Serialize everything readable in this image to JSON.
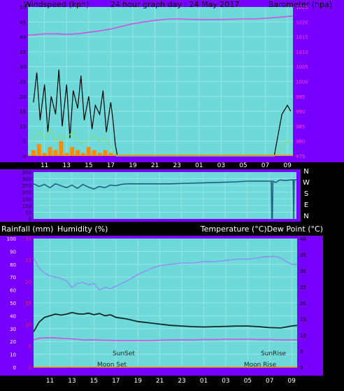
{
  "top_panel": {
    "left_title": "Windspeed (kph)",
    "center_title": "24 hour graph day : 24 May 2017",
    "right_title": "Barometer (hpa)"
  },
  "direction_letters": [
    "N",
    "W",
    "S",
    "E",
    "N"
  ],
  "bottom_panel": {
    "left_title_1": "Rainfall (mm)",
    "left_title_2": "Humidity (%)",
    "right_title": "Temperature (°C)Dew Point (°C)",
    "sunset_label": "SunSet",
    "sunrise_label": "SunRise",
    "moonset_label": "Moon Set",
    "moonrise_label": "Moon Rise"
  },
  "colors": {
    "frame": "#000000",
    "side": "#7700ff",
    "plot_bg": "#6fd9d9",
    "grid": "#9be8e8",
    "wind_gust": "#000000",
    "wind_avg": "#80e070",
    "rain": "#ff8c00",
    "barometer": "#d050e0",
    "direction": "#1f5f80",
    "humidity": "#8898f0",
    "temperature": "#102828",
    "dew_point": "#d050e0",
    "axis_red": "#ff2020"
  },
  "x_ticks": [
    "11",
    "13",
    "15",
    "17",
    "19",
    "21",
    "23",
    "01",
    "03",
    "05",
    "07",
    "09"
  ],
  "chart_data": [
    {
      "type": "line",
      "title": "24 hour graph day : 24 May 2017",
      "y_left_label": "Windspeed (kph)",
      "y_right_label": "Barometer (hpa)",
      "x_hours": [
        9.5,
        33.5
      ],
      "y_left_ticks": [
        "0",
        "5",
        "10",
        "15",
        "20",
        "25",
        "30",
        "35",
        "40",
        "45",
        "50"
      ],
      "y_left_range": [
        0,
        50
      ],
      "y_right_ticks": [
        "975",
        "980",
        "985",
        "990",
        "995",
        "1000",
        "1005",
        "1010",
        "1015",
        "1020",
        "1025"
      ],
      "y_right_range": [
        975,
        1025
      ],
      "series": [
        {
          "key": "gust",
          "x": [
            10,
            10.3,
            10.6,
            11,
            11.3,
            11.6,
            12,
            12.3,
            12.6,
            13,
            13.3,
            13.6,
            14,
            14.3,
            14.6,
            15,
            15.3,
            15.6,
            16,
            16.3,
            16.6,
            17,
            17.2,
            17.4,
            17.6,
            31.8,
            32,
            32.5,
            33,
            33.3
          ],
          "y": [
            18,
            28,
            12,
            24,
            8,
            20,
            14,
            29,
            10,
            24,
            6,
            22,
            16,
            27,
            12,
            20,
            9,
            17,
            14,
            22,
            8,
            18,
            12,
            4,
            0,
            0,
            4,
            14,
            17,
            15
          ]
        },
        {
          "key": "average",
          "x": [
            10,
            10.5,
            11,
            11.5,
            12,
            12.5,
            13,
            13.5,
            14,
            14.5,
            15,
            15.5,
            16,
            16.5,
            17,
            17.5,
            31.8,
            32.5,
            33,
            33.3
          ],
          "y": [
            5,
            8,
            6,
            9,
            5,
            7,
            6,
            8,
            5,
            4,
            6,
            7,
            5,
            6,
            3,
            0,
            0,
            3,
            5,
            4
          ]
        },
        {
          "key": "rain",
          "x": [
            10,
            10.5,
            11,
            11.5,
            12,
            12.5,
            13,
            13.5,
            14,
            14.5,
            15,
            15.5,
            16,
            16.5,
            17
          ],
          "y": [
            2,
            4,
            1,
            3,
            2,
            5,
            1,
            3,
            2,
            1,
            3,
            2,
            1,
            2,
            1
          ]
        },
        {
          "key": "barometer",
          "x": [
            9.5,
            11,
            12,
            13,
            14,
            15,
            16,
            17,
            18,
            19,
            20,
            21,
            22,
            23,
            24,
            25,
            26,
            27,
            28,
            29,
            30,
            31,
            32,
            33,
            33.5
          ],
          "y": [
            1015.5,
            1016,
            1016,
            1015.8,
            1016,
            1016.5,
            1017,
            1017.6,
            1018.5,
            1019.4,
            1020,
            1020.5,
            1020.9,
            1021,
            1020.9,
            1020.8,
            1020.8,
            1020.8,
            1020.9,
            1021,
            1021,
            1021.2,
            1021.5,
            1021.8,
            1022
          ]
        }
      ]
    },
    {
      "type": "line",
      "title": "",
      "y_left_ticks": [
        "0",
        "50",
        "100",
        "150",
        "200",
        "250",
        "300",
        "350"
      ],
      "y_left_range": [
        0,
        360
      ],
      "series": [
        {
          "key": "direction",
          "x": [
            9.5,
            10,
            10.5,
            11,
            11.5,
            12,
            12.5,
            13,
            13.5,
            14,
            14.5,
            15,
            15.5,
            16,
            16.5,
            17,
            17.5,
            18,
            22,
            26,
            28,
            29,
            30,
            31.2,
            31.25,
            31.3,
            31.35,
            31.6,
            32,
            32.5,
            33,
            33.2,
            33.25,
            33.3,
            33.5
          ],
          "y": [
            270,
            250,
            265,
            240,
            270,
            255,
            240,
            260,
            235,
            265,
            245,
            230,
            250,
            240,
            260,
            255,
            265,
            270,
            270,
            280,
            285,
            290,
            290,
            290,
            0,
            0,
            290,
            280,
            300,
            295,
            300,
            300,
            0,
            300,
            300
          ]
        }
      ]
    },
    {
      "type": "line",
      "title": "",
      "y_left_label": "Rainfall (mm) Humidity (%)",
      "y_right_label": "Temperature (°C)Dew Point (°C)",
      "y_left_ticks": [
        "0",
        "10",
        "20",
        "30",
        "40",
        "50",
        "60",
        "70",
        "80",
        "90",
        "100"
      ],
      "y_left_range": [
        0,
        100
      ],
      "y_left_red_ticks": [
        "0",
        "5",
        "10",
        "15",
        "20",
        "25",
        "30"
      ],
      "y_left_red_range": [
        0,
        30
      ],
      "y_right_ticks": [
        "0",
        "5",
        "10",
        "15",
        "20",
        "25",
        "30",
        "35",
        "40"
      ],
      "y_right_range": [
        0,
        40
      ],
      "series": [
        {
          "key": "humidity",
          "x": [
            9.5,
            10,
            10.5,
            11,
            11.5,
            12,
            12.5,
            13,
            13.5,
            14,
            14.5,
            15,
            15.5,
            16,
            16.5,
            17,
            18,
            19,
            20,
            21,
            22,
            23,
            24,
            25,
            26,
            27,
            28,
            29,
            30,
            30.5,
            31,
            31.5,
            32,
            32.5,
            33,
            33.5
          ],
          "y": [
            85,
            77,
            73,
            71,
            70,
            69,
            67,
            62,
            65,
            66,
            64,
            65,
            60,
            62,
            61,
            63,
            67,
            72,
            76,
            79,
            80,
            81,
            81,
            82,
            82,
            83,
            84,
            84,
            85,
            86,
            86,
            86,
            85,
            82,
            80,
            80
          ]
        },
        {
          "key": "temperature",
          "x": [
            9.5,
            10,
            10.5,
            11,
            11.5,
            12,
            12.5,
            13,
            13.5,
            14,
            14.5,
            15,
            15.5,
            16,
            16.5,
            17,
            18,
            19,
            20,
            21,
            22,
            23,
            24,
            25,
            26,
            27,
            28,
            29,
            30,
            31,
            32,
            32.5,
            33,
            33.5
          ],
          "y": [
            11,
            14,
            15.5,
            16,
            16.5,
            16.2,
            16.5,
            17,
            16.6,
            16.5,
            16.8,
            16.3,
            16.7,
            16,
            16.3,
            15.5,
            15,
            14.2,
            13.8,
            13.4,
            13,
            12.8,
            12.6,
            12.5,
            12.6,
            12.7,
            12.8,
            12.8,
            12.6,
            12.3,
            12.2,
            12.5,
            12.8,
            13
          ]
        },
        {
          "key": "dew_point",
          "x": [
            9.5,
            10,
            11,
            12,
            13,
            14,
            15,
            16,
            17,
            18,
            19,
            20,
            21,
            22,
            23,
            24,
            25,
            26,
            27,
            28,
            29,
            30,
            31,
            32,
            33,
            33.5
          ],
          "y": [
            8.5,
            9,
            9.2,
            9,
            8.8,
            8.5,
            8.5,
            8.4,
            8.3,
            8.3,
            8.3,
            8.3,
            8.4,
            8.5,
            8.5,
            8.5,
            8.6,
            8.6,
            8.7,
            8.7,
            8.7,
            8.6,
            8.6,
            8.5,
            8.5,
            8.5
          ]
        },
        {
          "key": "rainfall",
          "x": [
            9.5,
            33.5
          ],
          "y": [
            0,
            0
          ]
        }
      ]
    }
  ]
}
